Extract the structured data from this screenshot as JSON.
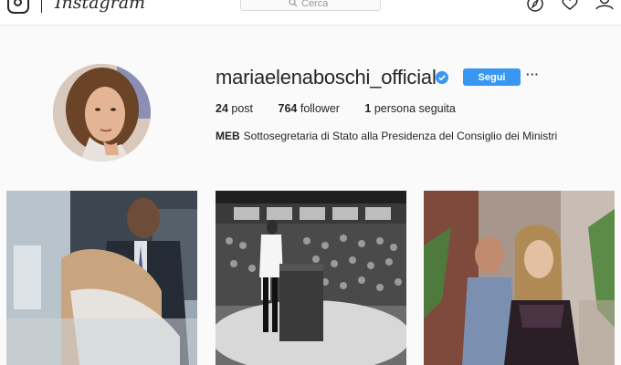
{
  "header": {
    "wordmark": "Instagram",
    "search": {
      "placeholder": "Cerca"
    },
    "nav": [
      {
        "name": "explore-icon"
      },
      {
        "name": "heart-icon"
      },
      {
        "name": "user-icon"
      }
    ]
  },
  "profile": {
    "username": "mariaelenaboschi_official",
    "verified": true,
    "follow_label": "Segui",
    "more_label": "···",
    "stats": {
      "posts_count": "24",
      "posts_label": "post",
      "followers_count": "764",
      "followers_label": "follower",
      "following_count": "1",
      "following_label": "persona seguita"
    },
    "bio": {
      "name": "MEB",
      "text": "Sottosegretaria di Stato alla Presidenza del Consiglio dei Ministri"
    }
  },
  "colors": {
    "accent": "#3897f0",
    "text": "#262626",
    "background": "#fafafa"
  }
}
